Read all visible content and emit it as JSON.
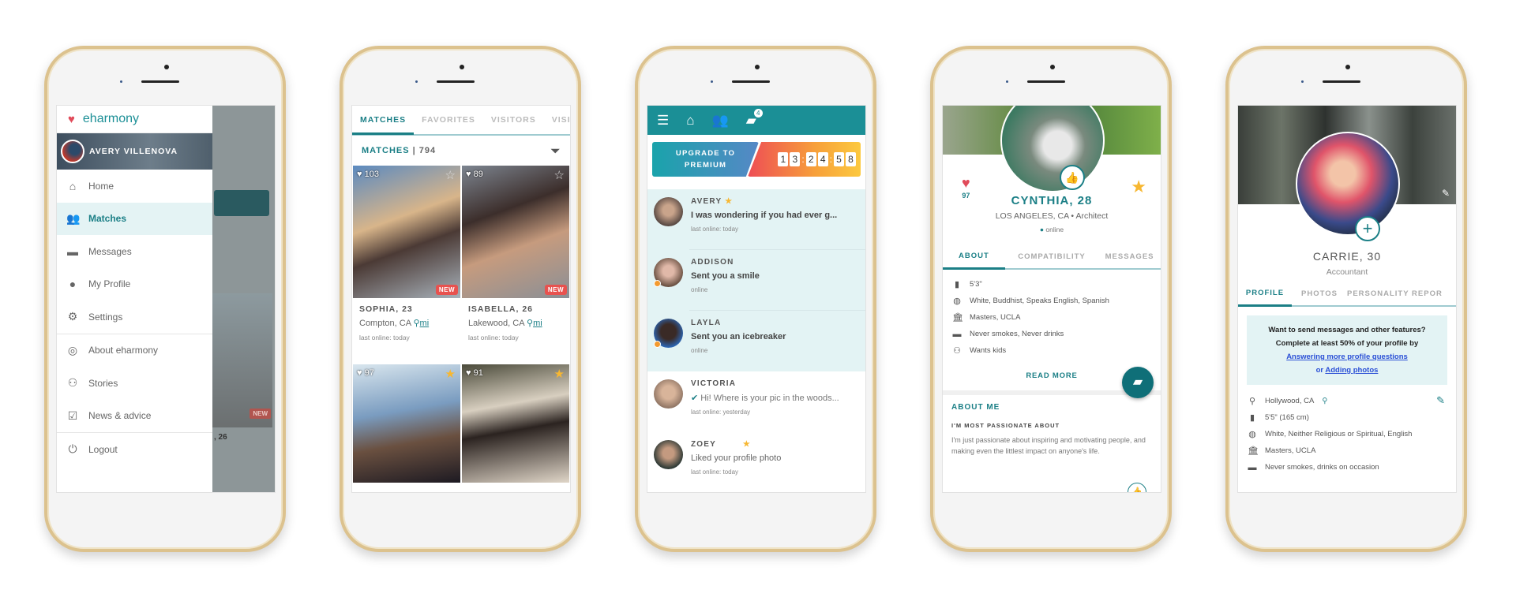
{
  "colors": {
    "brand_teal": "#1b8f96",
    "gold_frame": "#dcc28e",
    "new_badge": "#e8524f",
    "star": "#f7b731",
    "online_dot": "#f39a2f"
  },
  "menu_screen": {
    "logo": "eharmony",
    "user_name": "AVERY VILLENOVA",
    "items": [
      {
        "label": "Home",
        "icon": "home-icon"
      },
      {
        "label": "Matches",
        "icon": "matches-icon",
        "active": true
      },
      {
        "label": "Messages",
        "icon": "messages-icon"
      },
      {
        "label": "My Profile",
        "icon": "profile-icon"
      },
      {
        "label": "Settings",
        "icon": "gear-icon"
      },
      {
        "label": "About eharmony",
        "icon": "compass-icon"
      },
      {
        "label": "Stories",
        "icon": "stories-icon"
      },
      {
        "label": "News & advice",
        "icon": "news-icon"
      },
      {
        "label": "Logout",
        "icon": "power-icon"
      }
    ],
    "background": {
      "badge": "NEW",
      "name_fragment": ", 26"
    }
  },
  "matches_screen": {
    "tabs": [
      "MATCHES",
      "FAVORITES",
      "VISITORS",
      "VISIT"
    ],
    "header_label": "MATCHES",
    "header_count": "794",
    "cards": [
      {
        "score": "103",
        "name": "SOPHIA, 23",
        "location": "Compton, CA",
        "distance": "mi",
        "last": "last online: today",
        "badge": "NEW",
        "favorite": false
      },
      {
        "score": "89",
        "name": "ISABELLA, 26",
        "location": "Lakewood, CA",
        "distance": "mi",
        "last": "last online: today",
        "badge": "NEW",
        "favorite": false
      },
      {
        "score": "97",
        "favorite": true
      },
      {
        "score": "91",
        "favorite": true
      }
    ]
  },
  "messages_screen": {
    "badge_count": "4",
    "upgrade_label_1": "UPGRADE TO",
    "upgrade_label_2": "PREMIUM",
    "timer": [
      "1",
      "3",
      "2",
      "4",
      "5",
      "8"
    ],
    "conversations": [
      {
        "name": "AVERY",
        "text": "I was wondering if you had ever g...",
        "status": "last online: today",
        "starred": true,
        "unread": true
      },
      {
        "name": "ADDISON",
        "text": "Sent you a smile",
        "status": "online",
        "unread": true,
        "online": true
      },
      {
        "name": "LAYLA",
        "text": "Sent you an icebreaker",
        "status": "online",
        "unread": true,
        "online": true
      },
      {
        "name": "VICTORIA",
        "text": "Hi! Where is your pic in the woods...",
        "status": "last online: yesterday",
        "read_receipt": true
      },
      {
        "name": "ZOEY",
        "text": "Liked your profile photo",
        "status": "last online: today",
        "starred": true
      }
    ]
  },
  "match_profile_screen": {
    "score": "97",
    "name": "CYNTHIA, 28",
    "location": "LOS ANGELES, CA",
    "occupation": "Architect",
    "status": "online",
    "tabs": [
      "ABOUT",
      "COMPATIBILITY",
      "MESSAGES"
    ],
    "facts": [
      {
        "icon": "height-icon",
        "text": "5'3\""
      },
      {
        "icon": "globe-icon",
        "text": "White, Buddhist, Speaks English, Spanish"
      },
      {
        "icon": "education-icon",
        "text": "Masters, UCLA"
      },
      {
        "icon": "smoking-icon",
        "text": "Never smokes, Never drinks"
      },
      {
        "icon": "kids-icon",
        "text": "Wants kids"
      }
    ],
    "read_more": "READ MORE",
    "about_title": "ABOUT ME",
    "passion_title": "I'M MOST PASSIONATE ABOUT",
    "passion_text": "I'm just passionate about inspiring and motivating people, and making even the littlest impact on anyone's life."
  },
  "my_profile_screen": {
    "name": "CARRIE, 30",
    "occupation": "Accountant",
    "tabs": [
      "PROFILE",
      "PHOTOS",
      "PERSONALITY REPOR"
    ],
    "notice_line1": "Want to send messages and other features?",
    "notice_line2": "Complete at least 50% of your profile by",
    "notice_link1": "Answering more profile questions",
    "notice_or": "or",
    "notice_link2": "Adding photos",
    "facts": [
      {
        "icon": "location-icon",
        "text": "Hollywood, CA"
      },
      {
        "icon": "height-icon",
        "text": "5'5\" (165 cm)"
      },
      {
        "icon": "globe-icon",
        "text": "White, Neither Religious or Spiritual, English"
      },
      {
        "icon": "education-icon",
        "text": "Masters, UCLA"
      },
      {
        "icon": "smoking-icon",
        "text": "Never smokes, drinks on occasion"
      }
    ]
  }
}
